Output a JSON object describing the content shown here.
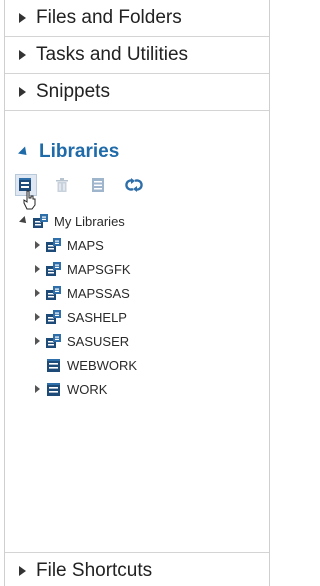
{
  "sections": {
    "files_folders": "Files and Folders",
    "tasks_utilities": "Tasks and Utilities",
    "snippets": "Snippets",
    "libraries": "Libraries",
    "file_shortcuts": "File Shortcuts"
  },
  "toolbar": {
    "icons": [
      "new-library-icon",
      "delete-icon",
      "properties-icon",
      "refresh-icon"
    ]
  },
  "tree": {
    "root": "My Libraries",
    "items": [
      "MAPS",
      "MAPSGFK",
      "MAPSSAS",
      "SASHELP",
      "SASUSER",
      "WEBWORK",
      "WORK"
    ]
  },
  "colors": {
    "accent": "#1f6aa8",
    "icon_blue": "#2f6fa9",
    "icon_dark": "#1e4a78"
  }
}
